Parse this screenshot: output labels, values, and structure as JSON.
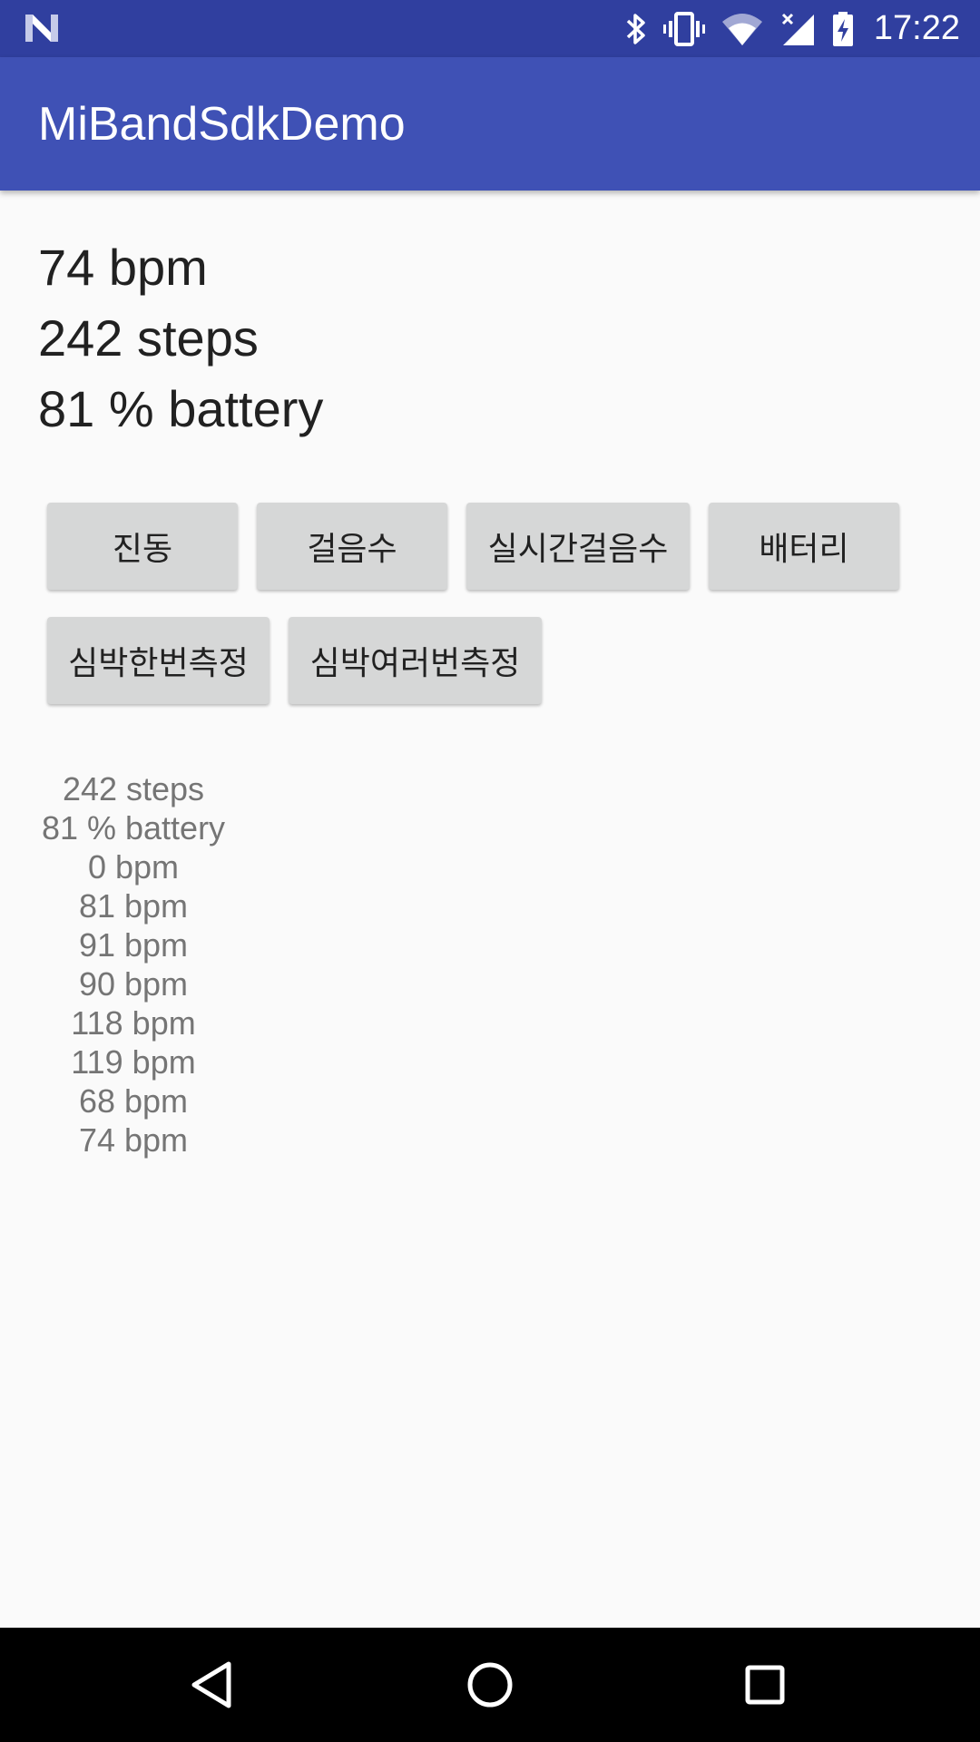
{
  "status_bar": {
    "time": "17:22",
    "icons": [
      "notification-n-icon",
      "bluetooth-icon",
      "vibrate-icon",
      "wifi-icon",
      "signal-icon",
      "battery-charging-icon"
    ]
  },
  "app_bar": {
    "title": "MiBandSdkDemo"
  },
  "readouts": {
    "heart_rate": "74 bpm",
    "steps": "242 steps",
    "battery": "81 % battery"
  },
  "buttons": {
    "vibrate": "진동",
    "steps": "걸음수",
    "realtime_steps": "실시간걸음수",
    "battery": "배터리",
    "heart_once": "심박한번측정",
    "heart_multi": "심박여러번측정"
  },
  "log": [
    "242 steps",
    "81 % battery",
    "0 bpm",
    "81 bpm",
    "91 bpm",
    "90 bpm",
    "118 bpm",
    "119 bpm",
    "68 bpm",
    "74 bpm"
  ],
  "nav_bar": {
    "icons": [
      "back-icon",
      "home-icon",
      "recents-icon"
    ]
  },
  "colors": {
    "status_bar": "#303f9f",
    "app_bar": "#3f51b5",
    "background": "#fafafa",
    "button": "#d6d7d7"
  }
}
